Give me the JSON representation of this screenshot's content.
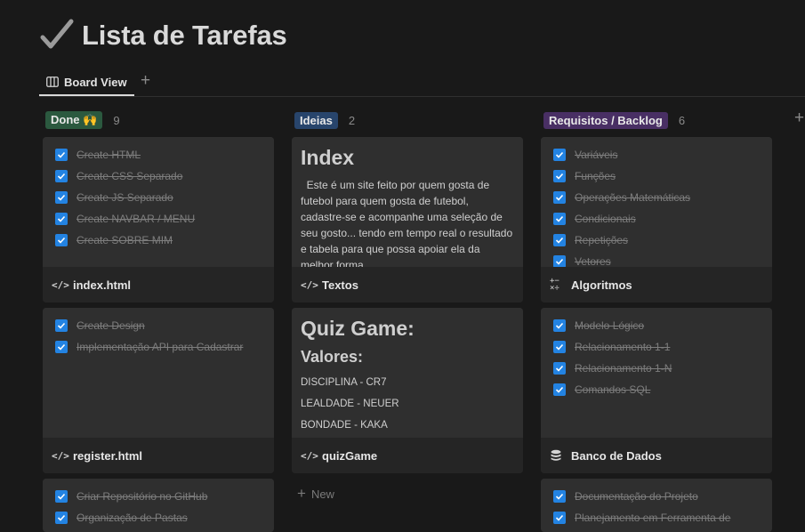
{
  "page": {
    "title": "Lista de Tarefas"
  },
  "views": {
    "active_label": "Board View",
    "add_symbol": "+"
  },
  "board": {
    "add_group_symbol": "+",
    "new_label": "New",
    "new_symbol": "+"
  },
  "columns": [
    {
      "label": "Done 🙌",
      "count": "9",
      "color": "#2b593f"
    },
    {
      "label": "Ideias",
      "count": "2",
      "color": "#28456c"
    },
    {
      "label": "Requisitos / Backlog",
      "count": "6",
      "color": "#492f64"
    }
  ],
  "cards": {
    "done1": {
      "items": [
        "Create HTML",
        "Create CSS Separado",
        "Create JS Separado",
        "Create NAVBAR / MENU",
        "Create SOBRE MIM"
      ],
      "icon": "</>",
      "title": "index.html"
    },
    "done2": {
      "items": [
        "Create Design",
        "Implementação API para Cadastrar"
      ],
      "icon": "</>",
      "title": "register.html"
    },
    "done3": {
      "items": [
        "Criar Repositório no GitHub",
        "Organização de Pastas"
      ]
    },
    "idea1": {
      "heading": "Index",
      "text": "  Este é um site feito por quem gosta de futebol para quem gosta de futebol, cadastre-se e acompanhe uma seleção de seu gosto... tendo em tempo real o resultado e tabela para que possa apoiar ela da melhor forma",
      "icon": "</>",
      "title": "Textos"
    },
    "idea2": {
      "heading": "Quiz Game:",
      "subheading": "Valores:",
      "lines": [
        "DISCIPLINA - CR7",
        "LEALDADE - NEUER",
        "BONDADE - KAKA"
      ],
      "icon": "</>",
      "title": "quizGame"
    },
    "req1": {
      "items": [
        "Variáveis",
        "Funções",
        "Operações Matemáticas",
        "Condicionais",
        "Repetições",
        "Vetores"
      ],
      "icon": "+− ×÷",
      "title": "Algoritmos"
    },
    "req2": {
      "items": [
        "Modelo Lógico",
        "Relacionamento 1-1",
        "Relacionamento 1-N",
        "Comandos SQL"
      ],
      "icon": "database-icon",
      "title": "Banco de Dados"
    },
    "req3": {
      "items": [
        "Documentação do Projeto",
        "Planejamento em Ferramenta de"
      ]
    }
  }
}
